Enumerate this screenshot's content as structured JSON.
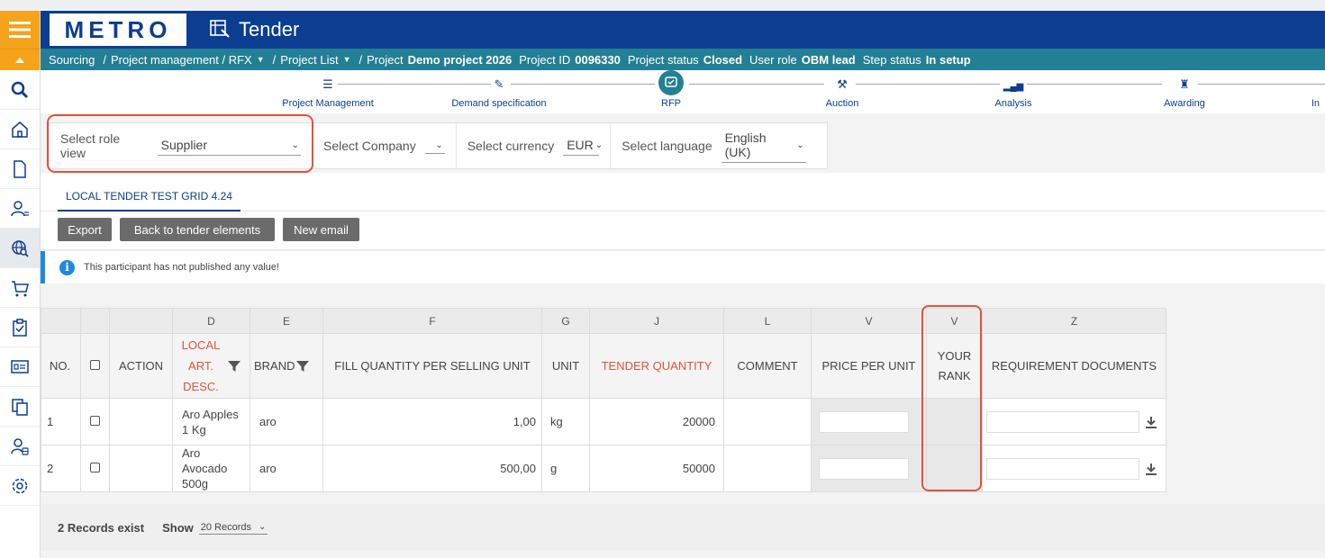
{
  "header": {
    "logo": "METRO",
    "app_title": "Tender"
  },
  "breadcrumb": {
    "items": [
      "Sourcing",
      "Project management / RFX",
      "Project List",
      "Project"
    ],
    "project_name": "Demo project 2026",
    "project_id_label": "Project ID",
    "project_id": "0096330",
    "project_status_label": "Project status",
    "project_status": "Closed",
    "user_role_label": "User role",
    "user_role": "OBM lead",
    "step_status_label": "Step status",
    "step_status": "In setup"
  },
  "steps": [
    {
      "label": "Project Management",
      "icon": "list-icon"
    },
    {
      "label": "Demand specification",
      "icon": "pen-icon"
    },
    {
      "label": "RFP",
      "icon": "rfp-icon",
      "active": true
    },
    {
      "label": "Auction",
      "icon": "gavel-icon"
    },
    {
      "label": "Analysis",
      "icon": "bar-chart-icon"
    },
    {
      "label": "Awarding",
      "icon": "award-icon"
    },
    {
      "label": "In",
      "icon": ""
    }
  ],
  "filters": {
    "role_label": "Select role view",
    "role_value": "Supplier",
    "company_label": "Select Company",
    "company_value": "",
    "currency_label": "Select currency",
    "currency_value": "EUR",
    "language_label": "Select language",
    "language_value": "English (UK)"
  },
  "tab": {
    "label": "LOCAL TENDER TEST GRID 4.24"
  },
  "buttons": {
    "export": "Export",
    "back": "Back to tender elements",
    "new_email": "New email"
  },
  "info": {
    "message": "This participant has not published any value!"
  },
  "grid": {
    "column_letters": [
      "",
      "",
      "",
      "D",
      "E",
      "F",
      "G",
      "J",
      "L",
      "V",
      "V",
      "Z"
    ],
    "headers": {
      "no": "NO.",
      "action": "ACTION",
      "local_desc": "LOCAL ART. DESC.",
      "brand": "BRAND",
      "fill_qty": "FILL QUANTITY PER SELLING UNIT",
      "unit": "UNIT",
      "tender_qty": "TENDER QUANTITY",
      "comment": "COMMENT",
      "price": "PRICE PER UNIT",
      "rank": "YOUR RANK",
      "req_docs": "REQUIREMENT DOCUMENTS"
    },
    "rows": [
      {
        "no": "1",
        "desc": "Aro Apples 1 Kg",
        "brand": "aro",
        "fill_qty": "1,00",
        "unit": "kg",
        "tender_qty": "20000"
      },
      {
        "no": "2",
        "desc": "Aro Avocado 500g",
        "brand": "aro",
        "fill_qty": "500,00",
        "unit": "g",
        "tender_qty": "50000"
      }
    ]
  },
  "footer": {
    "records": "2 Records exist",
    "show_label": "Show",
    "show_value": "20 Records"
  },
  "colors": {
    "brand": "#0b3d91",
    "accent": "#f5a31a",
    "breadcrumb": "#237f93",
    "highlight": "#e0533a"
  }
}
